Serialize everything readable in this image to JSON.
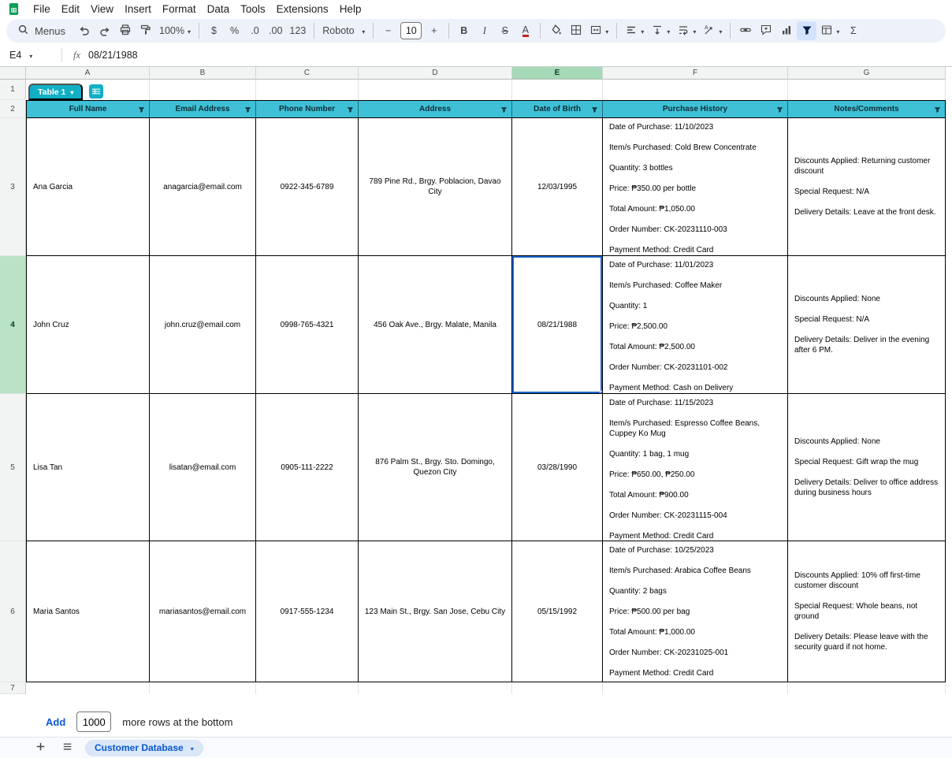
{
  "menubar": {
    "items": [
      "File",
      "Edit",
      "View",
      "Insert",
      "Format",
      "Data",
      "Tools",
      "Extensions",
      "Help"
    ]
  },
  "toolbar": {
    "menus_label": "Menus",
    "zoom": "100%",
    "currency": "$",
    "percent": "%",
    "decrease_decimal": ".0",
    "increase_decimal": ".00",
    "more_formats": "123",
    "font": "Roboto",
    "font_size_minus": "−",
    "font_size": "10",
    "font_size_plus": "+",
    "bold": "B",
    "italic": "I",
    "strikethrough": "S",
    "text_color": "A",
    "functions": "Σ"
  },
  "formula_bar": {
    "cell_ref": "E4",
    "fx_label": "fx",
    "value": "08/21/1988"
  },
  "grid": {
    "column_headers": [
      "A",
      "B",
      "C",
      "D",
      "E",
      "F",
      "G"
    ],
    "row_headers": [
      "1",
      "2",
      "3",
      "4",
      "5",
      "6",
      "7"
    ],
    "selected_cell": "E4"
  },
  "table": {
    "name": "Table 1",
    "headers": [
      "Full Name",
      "Email Address",
      "Phone Number",
      "Address",
      "Date of Birth",
      "Purchase History",
      "Notes/Comments"
    ],
    "rows": [
      {
        "full_name": "Ana Garcia",
        "email": "anagarcia@email.com",
        "phone": "0922-345-6789",
        "address": "789 Pine Rd., Brgy. Poblacion, Davao City",
        "date_of_birth": "12/03/1995",
        "purchase_history": [
          "Date of Purchase: 11/10/2023",
          "Item/s Purchased: Cold Brew Concentrate",
          "Quantity: 3 bottles",
          "Price: ₱350.00 per bottle",
          "Total Amount: ₱1,050.00",
          "Order Number: CK-20231110-003",
          "Payment Method: Credit Card"
        ],
        "notes": [
          "Discounts Applied: Returning customer discount",
          "Special Request: N/A",
          "Delivery Details: Leave at the front desk."
        ]
      },
      {
        "full_name": "John Cruz",
        "email": "john.cruz@email.com",
        "phone": "0998-765-4321",
        "address": "456 Oak Ave., Brgy. Malate, Manila",
        "date_of_birth": "08/21/1988",
        "purchase_history": [
          "Date of Purchase: 11/01/2023",
          "Item/s Purchased: Coffee Maker",
          "Quantity: 1",
          "Price: ₱2,500.00",
          "Total Amount: ₱2,500.00",
          "Order Number: CK-20231101-002",
          "Payment Method: Cash on Delivery"
        ],
        "notes": [
          "Discounts Applied: None",
          "Special Request: N/A",
          "Delivery Details: Deliver in the evening after 6 PM."
        ]
      },
      {
        "full_name": "Lisa Tan",
        "email": "lisatan@email.com",
        "phone": "0905-111-2222",
        "address": "876 Palm St., Brgy. Sto. Domingo, Quezon City",
        "date_of_birth": "03/28/1990",
        "purchase_history": [
          "Date of Purchase: 11/15/2023",
          "Item/s Purchased: Espresso Coffee Beans, Cuppey Ko Mug",
          "Quantity: 1 bag, 1 mug",
          "Price: ₱650.00, ₱250.00",
          "Total Amount: ₱900.00",
          "Order Number: CK-20231115-004",
          "Payment Method: Credit Card"
        ],
        "notes": [
          "Discounts Applied: None",
          "Special Request: Gift wrap the mug",
          "Delivery Details: Deliver to office address during business hours"
        ]
      },
      {
        "full_name": "Maria Santos",
        "email": "mariasantos@email.com",
        "phone": "0917-555-1234",
        "address": "123 Main St., Brgy. San Jose, Cebu City",
        "date_of_birth": "05/15/1992",
        "purchase_history": [
          "Date of Purchase: 10/25/2023",
          "Item/s Purchased: Arabica Coffee Beans",
          "Quantity: 2 bags",
          "Price: ₱500.00 per bag",
          "Total Amount: ₱1,000.00",
          "Order Number: CK-20231025-001",
          "Payment Method: Credit Card"
        ],
        "notes": [
          "Discounts Applied: 10% off first-time customer discount",
          "Special Request: Whole beans, not ground",
          "Delivery Details: Please leave with the security guard if not home."
        ]
      }
    ]
  },
  "footer": {
    "add_button": "Add",
    "row_count": "1000",
    "add_suffix": "more rows at the bottom"
  },
  "sheet_bar": {
    "active_tab": "Customer Database"
  },
  "colors": {
    "table_header": "#3fc0d6",
    "table_chip": "#12afc4",
    "selection_blue": "#1967d2",
    "selected_header_green": "#a5d9b7",
    "active_tab_text": "#0b57d0",
    "toolbar_bg": "#edf2fa"
  }
}
